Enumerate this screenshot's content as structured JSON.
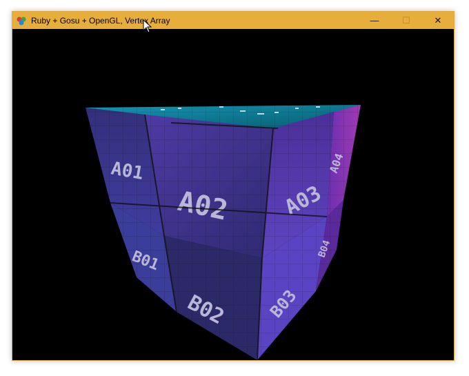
{
  "window": {
    "title": "Ruby + Gosu + OpenGL, Vertex Array",
    "controls": {
      "minimize": "—",
      "maximize": "☐",
      "close": "✕"
    }
  },
  "scene": {
    "faces": {
      "top": "",
      "front_left": {
        "A01": "A01",
        "B01": "B01"
      },
      "front_main": {
        "A02": "A02",
        "B02": "B02"
      },
      "right": {
        "A03": "A03",
        "B03": "B03"
      },
      "far_right": {
        "A04": "A04",
        "B04": "B04"
      }
    }
  },
  "colors": {
    "titlebar": "#e8ae3c",
    "background": "#000000",
    "top_face": "#0b6f86",
    "left_face": "#3a3a92",
    "front_face": "#44328f",
    "right_face": "#5a2d9a",
    "far_right_face": "#8a2aa8"
  }
}
